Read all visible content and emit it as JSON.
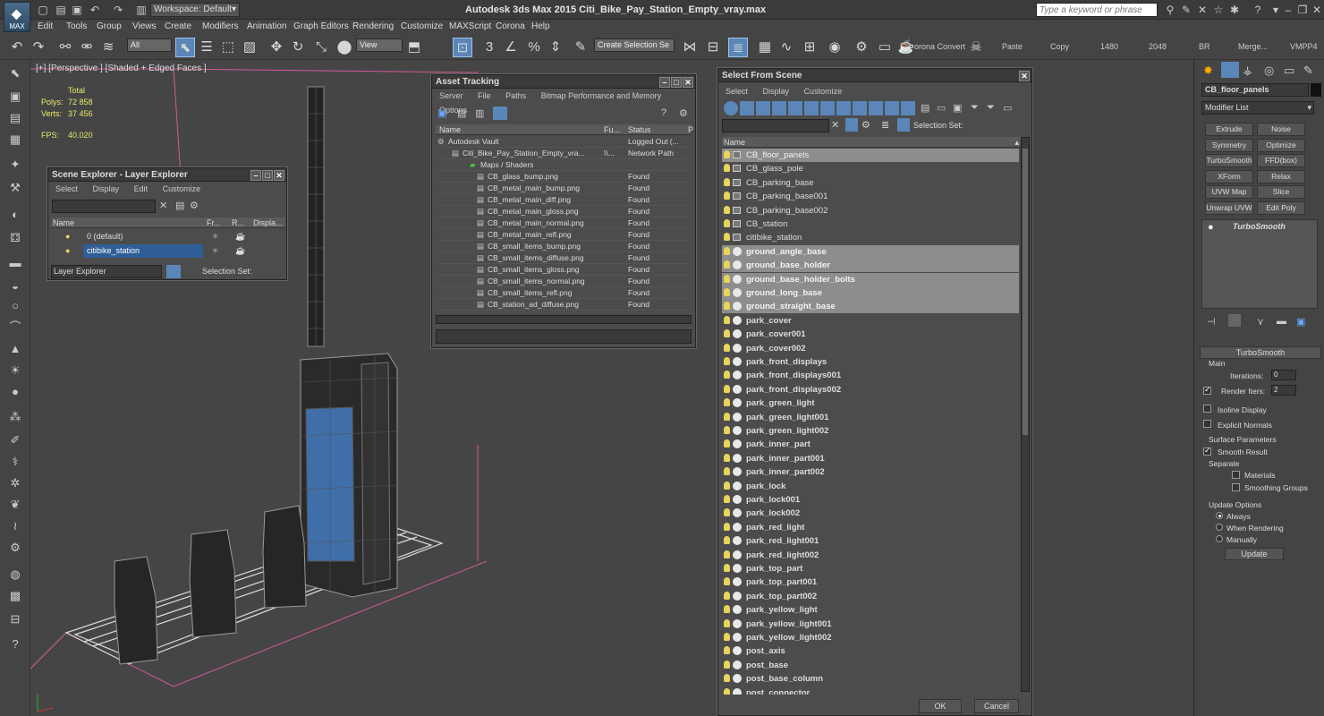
{
  "app": {
    "title": "Autodesk 3ds Max  2015      Citi_Bike_Pay_Station_Empty_vray.max",
    "workspace": "Workspace: Default",
    "search_placeholder": "Type a keyword or phrase",
    "logo_text": "MAX"
  },
  "menu": [
    "Edit",
    "Tools",
    "Group",
    "Views",
    "Create",
    "Modifiers",
    "Animation",
    "Graph Editors",
    "Rendering",
    "Customize",
    "MAXScript",
    "Corona",
    "Help"
  ],
  "toolbar": {
    "filter": "All",
    "view": "View",
    "selection_set": "Create Selection Se",
    "corona_convert": "orona Convert",
    "paste": "Paste",
    "copy": "Copy",
    "size_1480": "1480",
    "size_2048": "2048",
    "br": "BR",
    "merge": "Merge...",
    "vmpp4": "VMPP4"
  },
  "viewport": {
    "label": "[+] [Perspective ] [Shaded + Edged Faces ]",
    "stats": {
      "total_label": "Total",
      "polys_label": "Polys:",
      "polys": "72 858",
      "verts_label": "Verts:",
      "verts": "37 456",
      "fps_label": "FPS:",
      "fps": "40.020"
    }
  },
  "scene_explorer": {
    "title": "Scene Explorer - Layer Explorer",
    "menu": [
      "Select",
      "Display",
      "Edit",
      "Customize"
    ],
    "columns": [
      "Name",
      "Fr...",
      "R...",
      "Displa..."
    ],
    "rows": [
      "0 (default)",
      "citibike_station"
    ],
    "footer_dropdown": "Layer Explorer",
    "selection_set": "Selection Set:"
  },
  "asset_tracking": {
    "title": "Asset Tracking",
    "menu": [
      "Server",
      "File",
      "Paths",
      "Bitmap Performance and Memory",
      "Options"
    ],
    "columns": [
      "Name",
      "Fu...",
      "Status",
      "P"
    ],
    "rows": [
      {
        "name": "Autodesk Vault",
        "full": "",
        "status": "Logged Out (..."
      },
      {
        "name": "Citi_Bike_Pay_Station_Empty_vra...",
        "full": "\\\\...",
        "status": "Network Path"
      },
      {
        "name": "Maps / Shaders",
        "full": "",
        "status": ""
      },
      {
        "name": "CB_glass_bump.png",
        "full": "",
        "status": "Found"
      },
      {
        "name": "CB_metal_main_bump.png",
        "full": "",
        "status": "Found"
      },
      {
        "name": "CB_metal_main_diff.png",
        "full": "",
        "status": "Found"
      },
      {
        "name": "CB_metal_main_gloss.png",
        "full": "",
        "status": "Found"
      },
      {
        "name": "CB_metal_main_normal.png",
        "full": "",
        "status": "Found"
      },
      {
        "name": "CB_metal_main_refl.png",
        "full": "",
        "status": "Found"
      },
      {
        "name": "CB_small_items_bump.png",
        "full": "",
        "status": "Found"
      },
      {
        "name": "CB_small_items_diffuse.png",
        "full": "",
        "status": "Found"
      },
      {
        "name": "CB_small_items_gloss.png",
        "full": "",
        "status": "Found"
      },
      {
        "name": "CB_small_items_normal.png",
        "full": "",
        "status": "Found"
      },
      {
        "name": "CB_small_items_refl.png",
        "full": "",
        "status": "Found"
      },
      {
        "name": "CB_station_ad_diffuse.png",
        "full": "",
        "status": "Found"
      }
    ]
  },
  "select_from_scene": {
    "title": "Select From Scene",
    "menu": [
      "Select",
      "Display",
      "Customize"
    ],
    "selection_set": "Selection Set:",
    "column": "Name",
    "ok": "OK",
    "cancel": "Cancel",
    "rows": [
      {
        "name": "CB_floor_panels",
        "type": "geo",
        "hi": true
      },
      {
        "name": "CB_glass_pole",
        "type": "geo",
        "hi": false
      },
      {
        "name": "CB_parking_base",
        "type": "geo",
        "hi": false
      },
      {
        "name": "CB_parking_base001",
        "type": "geo",
        "hi": false
      },
      {
        "name": "CB_parking_base002",
        "type": "geo",
        "hi": false
      },
      {
        "name": "CB_station",
        "type": "geo",
        "hi": false
      },
      {
        "name": "citibike_station",
        "type": "geo",
        "hi": false
      },
      {
        "name": "ground_angle_base",
        "type": "sph",
        "hi": true
      },
      {
        "name": "ground_base_holder",
        "type": "sph",
        "hi": true
      },
      {
        "name": "ground_base_holder_bolts",
        "type": "sph",
        "hi": true
      },
      {
        "name": "ground_long_base",
        "type": "sph",
        "hi": true
      },
      {
        "name": "ground_straight_base",
        "type": "sph",
        "hi": true
      },
      {
        "name": "park_cover",
        "type": "sph",
        "hi": false
      },
      {
        "name": "park_cover001",
        "type": "sph",
        "hi": false
      },
      {
        "name": "park_cover002",
        "type": "sph",
        "hi": false
      },
      {
        "name": "park_front_displays",
        "type": "sph",
        "hi": false
      },
      {
        "name": "park_front_displays001",
        "type": "sph",
        "hi": false
      },
      {
        "name": "park_front_displays002",
        "type": "sph",
        "hi": false
      },
      {
        "name": "park_green_light",
        "type": "sph",
        "hi": false
      },
      {
        "name": "park_green_light001",
        "type": "sph",
        "hi": false
      },
      {
        "name": "park_green_light002",
        "type": "sph",
        "hi": false
      },
      {
        "name": "park_inner_part",
        "type": "sph",
        "hi": false
      },
      {
        "name": "park_inner_part001",
        "type": "sph",
        "hi": false
      },
      {
        "name": "park_inner_part002",
        "type": "sph",
        "hi": false
      },
      {
        "name": "park_lock",
        "type": "sph",
        "hi": false
      },
      {
        "name": "park_lock001",
        "type": "sph",
        "hi": false
      },
      {
        "name": "park_lock002",
        "type": "sph",
        "hi": false
      },
      {
        "name": "park_red_light",
        "type": "sph",
        "hi": false
      },
      {
        "name": "park_red_light001",
        "type": "sph",
        "hi": false
      },
      {
        "name": "park_red_light002",
        "type": "sph",
        "hi": false
      },
      {
        "name": "park_top_part",
        "type": "sph",
        "hi": false
      },
      {
        "name": "park_top_part001",
        "type": "sph",
        "hi": false
      },
      {
        "name": "park_top_part002",
        "type": "sph",
        "hi": false
      },
      {
        "name": "park_yellow_light",
        "type": "sph",
        "hi": false
      },
      {
        "name": "park_yellow_light001",
        "type": "sph",
        "hi": false
      },
      {
        "name": "park_yellow_light002",
        "type": "sph",
        "hi": false
      },
      {
        "name": "post_axis",
        "type": "sph",
        "hi": false
      },
      {
        "name": "post_base",
        "type": "sph",
        "hi": false
      },
      {
        "name": "post_base_column",
        "type": "sph",
        "hi": false
      },
      {
        "name": "post_connector",
        "type": "sph",
        "hi": false
      }
    ]
  },
  "command_panel": {
    "object_name": "CB_floor_panels",
    "modifier_list": "Modifier List",
    "modifier_buttons": [
      "Extrude",
      "Noise",
      "Symmetry",
      "Optimize",
      "TurboSmooth",
      "FFD(box)",
      "XForm",
      "Relax",
      "UVW Map",
      "Slice",
      "Unwrap UVW",
      "Edit Poly"
    ],
    "stack_item": "TurboSmooth",
    "rollout_title": "TurboSmooth",
    "main_label": "Main",
    "iterations_label": "Iterations:",
    "iterations": "0",
    "render_iters_label": "Render Iters:",
    "render_iters": "2",
    "isoline": "Isoline Display",
    "explicit_normals": "Explicit Normals",
    "surface_params": "Surface Parameters",
    "smooth_result": "Smooth Result",
    "separate": "Separate",
    "materials": "Materials",
    "smoothing_groups": "Smoothing Groups",
    "update_options": "Update Options",
    "always": "Always",
    "when_rendering": "When Rendering",
    "manually": "Manually",
    "update": "Update"
  },
  "colors": {
    "accent": "#5a86b8",
    "highlight_row": "#8d8d8d",
    "wire_pink": "#d05a9a",
    "stats_yellow": "#e8e86a"
  }
}
